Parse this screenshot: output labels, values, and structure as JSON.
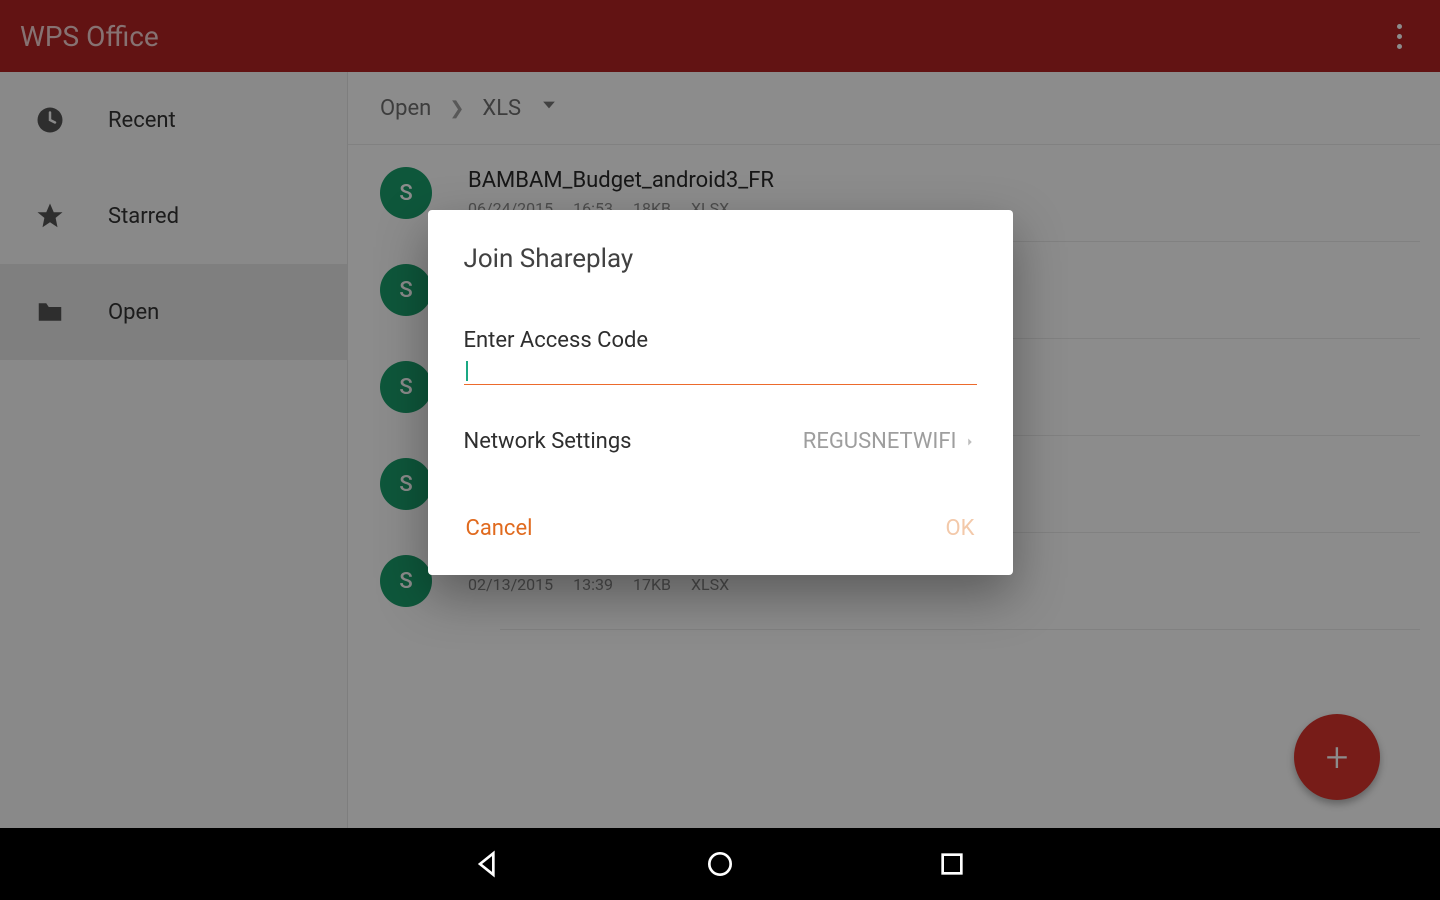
{
  "header": {
    "title": "WPS Office"
  },
  "sidebar": {
    "items": [
      {
        "label": "Recent",
        "icon": "clock-icon"
      },
      {
        "label": "Starred",
        "icon": "star-icon"
      },
      {
        "label": "Open",
        "icon": "folder-icon"
      }
    ]
  },
  "breadcrumb": {
    "first": "Open",
    "second": "XLS"
  },
  "files": [
    {
      "name": "BAMBAM_Budget_android3_FR",
      "date": "06/24/2015",
      "time": "16:53",
      "size": "18KB",
      "type": "XLSX"
    },
    {
      "name": "",
      "date": "",
      "time": "",
      "size": "",
      "type": ""
    },
    {
      "name": "",
      "date": "",
      "time": "",
      "size": "",
      "type": ""
    },
    {
      "name": "",
      "date": "",
      "time": "",
      "size": "",
      "type": ""
    },
    {
      "name": "",
      "date": "02/13/2015",
      "time": "13:39",
      "size": "17KB",
      "type": "XLSX"
    }
  ],
  "dialog": {
    "title": "Join Shareplay",
    "access_label": "Enter Access Code",
    "access_value": "",
    "network_label": "Network Settings",
    "network_value": "REGUSNETWIFI",
    "cancel": "Cancel",
    "ok": "OK"
  },
  "file_badge": "S",
  "colors": {
    "brand_red": "#b32424",
    "accent_orange": "#e06a1e",
    "spreadsheet_green": "#1a9e6c",
    "fab_red": "#d9332d"
  }
}
